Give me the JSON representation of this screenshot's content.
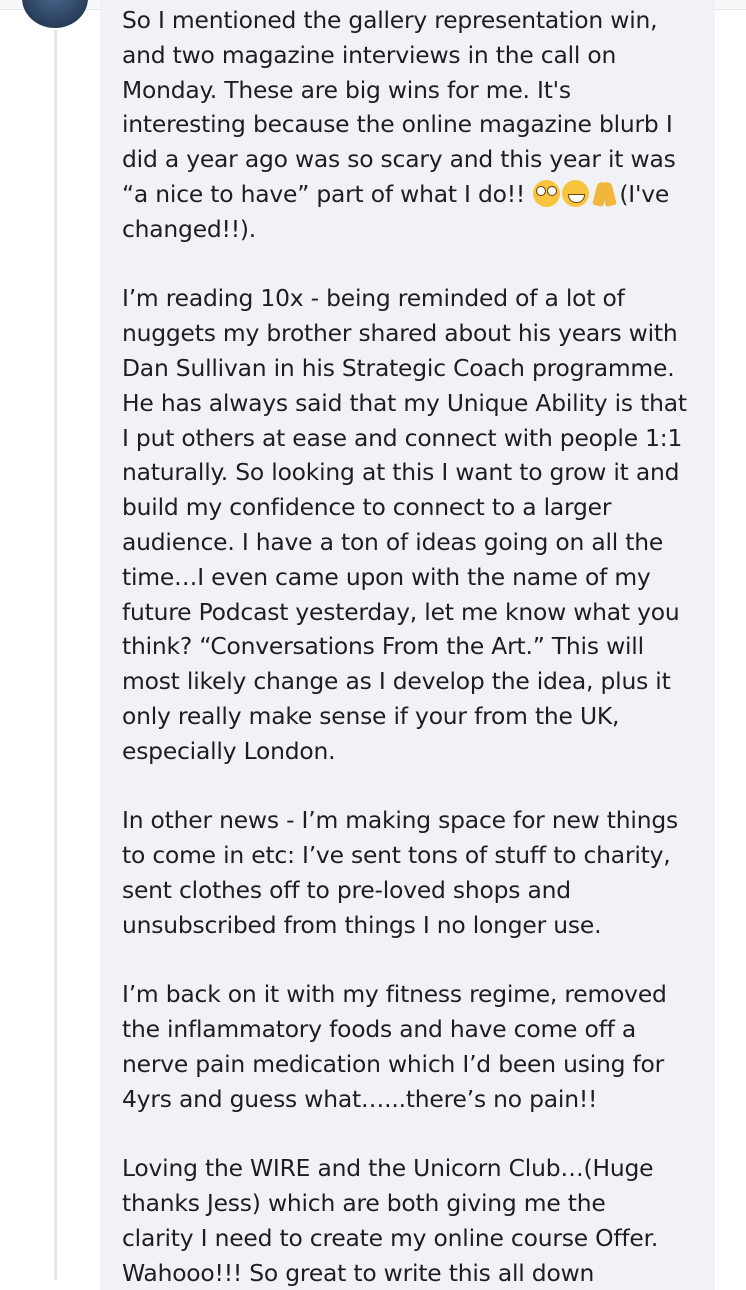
{
  "comment": {
    "paragraphs": [
      {
        "lines": [
          "So I mentioned the gallery representation win,",
          "and two magazine interviews in the call on",
          "Monday. These are big wins for me.  It's",
          "interesting because the online magazine blurb I",
          "did a year ago was so scary and this year it was",
          "“a nice to have” part of what I do!!",
          "changed!!)."
        ],
        "emoji_tail": "(I've"
      },
      {
        "lines": [
          "I’m reading 10x - being reminded of a lot of",
          "nuggets my brother shared about his years with",
          "Dan Sullivan in his Strategic Coach programme.",
          "He has always said that my Unique Ability is that",
          "I put  others at ease and connect with people 1:1",
          "naturally. So looking at this I want to grow it and",
          "build my confidence to connect to a larger",
          "audience. I have a ton of ideas going on all the",
          "time…I even came upon with the name of my",
          "future Podcast yesterday, let me know what you",
          "think?  “Conversations From the Art.” This will",
          "most likely change as I develop the idea, plus it",
          "only really make sense if your from the UK,",
          "especially London."
        ]
      },
      {
        "lines": [
          "In other news - I’m making space for new things",
          "to come in etc: I’ve sent tons of stuff to charity,",
          "sent clothes off to pre-loved shops and",
          "unsubscribed from things I no longer use."
        ]
      },
      {
        "lines": [
          "I’m back on it with my fitness regime, removed",
          "the inflammatory foods and have come off a",
          "nerve pain medication which I’d been using for",
          "4yrs and guess what…...there’s no pain!!"
        ]
      },
      {
        "lines": [
          "Loving the WIRE and the Unicorn Club…(Huge",
          "thanks Jess)  which are both giving me the",
          "clarity I need to create my online course Offer.",
          "Wahooo!!! So great to write this all down"
        ]
      }
    ],
    "emojis": [
      "flushed-face",
      "grinning-face",
      "folded-hands"
    ]
  },
  "colors": {
    "bubble": "#f0f2f5",
    "text": "#1c1e21",
    "thread_line": "#e3e5e9"
  }
}
